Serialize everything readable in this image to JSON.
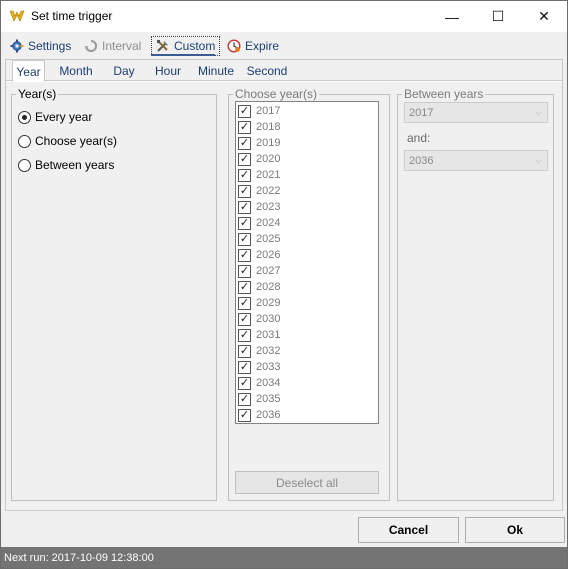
{
  "window": {
    "title": "Set time trigger",
    "minimize": "—",
    "maximize": "☐",
    "close": "✕"
  },
  "top_tabs": [
    {
      "label": "Settings",
      "icon": "settings-gear-icon",
      "state": "normal"
    },
    {
      "label": "Interval",
      "icon": "interval-refresh-icon",
      "state": "disabled"
    },
    {
      "label": "Custom",
      "icon": "custom-tools-icon",
      "state": "active"
    },
    {
      "label": "Expire",
      "icon": "expire-clock-icon",
      "state": "normal"
    }
  ],
  "sub_tabs": [
    "Year",
    "Month",
    "Day",
    "Hour",
    "Minute",
    "Second"
  ],
  "active_sub_tab": "Year",
  "years_group": {
    "title": "Year(s)",
    "options": [
      {
        "label": "Every year",
        "selected": true
      },
      {
        "label": "Choose year(s)",
        "selected": false
      },
      {
        "label": "Between years",
        "selected": false
      }
    ]
  },
  "choose_group": {
    "title": "Choose year(s)",
    "years": [
      "2017",
      "2018",
      "2019",
      "2020",
      "2021",
      "2022",
      "2023",
      "2024",
      "2025",
      "2026",
      "2027",
      "2028",
      "2029",
      "2030",
      "2031",
      "2032",
      "2033",
      "2034",
      "2035",
      "2036"
    ],
    "check_mark": "✓",
    "deselect_label": "Deselect all"
  },
  "between_group": {
    "title": "Between years",
    "from_value": "2017",
    "and_label": "and:",
    "to_value": "2036",
    "arrow": "⌵"
  },
  "buttons": {
    "cancel": "Cancel",
    "ok": "Ok"
  },
  "status": {
    "text": "Next run: 2017-10-09 12:38:00"
  },
  "colors": {
    "accent": "#3b5c93",
    "status_bg": "#737373",
    "tab_text": "#1b3f74"
  }
}
